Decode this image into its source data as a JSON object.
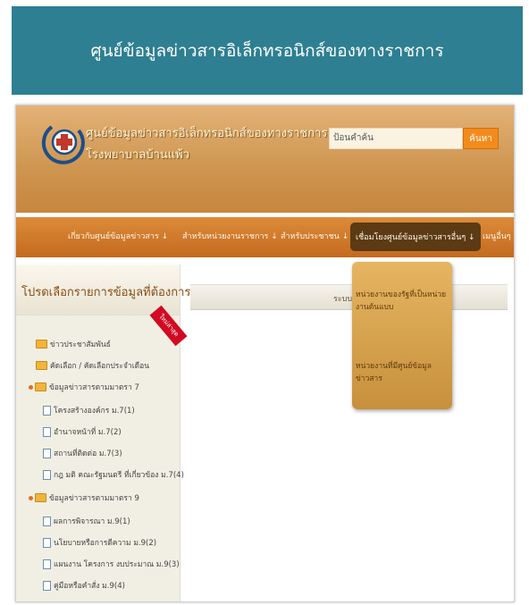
{
  "banner": {
    "title": "ศูนย์ข้อมูลข่าวสารอิเล็กทรอนิกส์ของทางราชการ"
  },
  "site": {
    "title_line1": "ศูนย์ข้อมูลข่าวสารอิเล็กทรอนิกส์ของทางราชการ",
    "title_line2": "โรงพยาบาลบ้านแพ้ว"
  },
  "search": {
    "placeholder": "ป้อนคำค้น",
    "button": "ค้นหา"
  },
  "nav": {
    "items": [
      "เกี่ยวกับศูนย์ข้อมูลข่าวสาร ↓",
      "สำหรับหน่วยงานราชการ ↓",
      "สำหรับประชาชน ↓",
      "เชื่อมโยงศูนย์ข้อมูลข่าวสารอื่นๆ ↓",
      "เมนูอื่นๆ"
    ]
  },
  "dropdown": {
    "items": [
      "หน่วยงานของรัฐที่เป็นหน่วยงานต้นแบบ",
      "หน่วยงานที่มีศูนย์ข้อมูลข่าวสาร"
    ]
  },
  "sidebar": {
    "heading": "โปรดเลือกรายการข้อมูลที่ต้องการ",
    "ribbon": "ใหม่ล่าสุด",
    "items": [
      "ข่าวประชาสัมพันธ์",
      "คัดเลือก / คัดเลือกประจำเดือน",
      "ข้อมูลข่าวสารตามมาตรา 7",
      "โครงสร้างองค์กร ม.7(1)",
      "อำนาจหน้าที่ ม.7(2)",
      "สถานที่ติดต่อ ม.7(3)",
      "กฎ มติ คณะรัฐมนตรี ที่เกี่ยวข้อง ม.7(4)",
      "ข้อมูลข่าวสารตามมาตรา 9",
      "ผลการพิจารณา ม.9(1)",
      "นโยบายหรือการตีความ ม.9(2)",
      "แผนงาน โครงการ งบประมาณ ม.9(3)",
      "คู่มือหรือคำสั่ง ม.9(4)"
    ]
  },
  "main": {
    "bar_text": "ระบบค้นหาจ่าย"
  },
  "colors": {
    "banner": "#2e7f92",
    "nav": "#c46a1e",
    "accent": "#f28b1c",
    "ribbon": "#d10a22"
  }
}
